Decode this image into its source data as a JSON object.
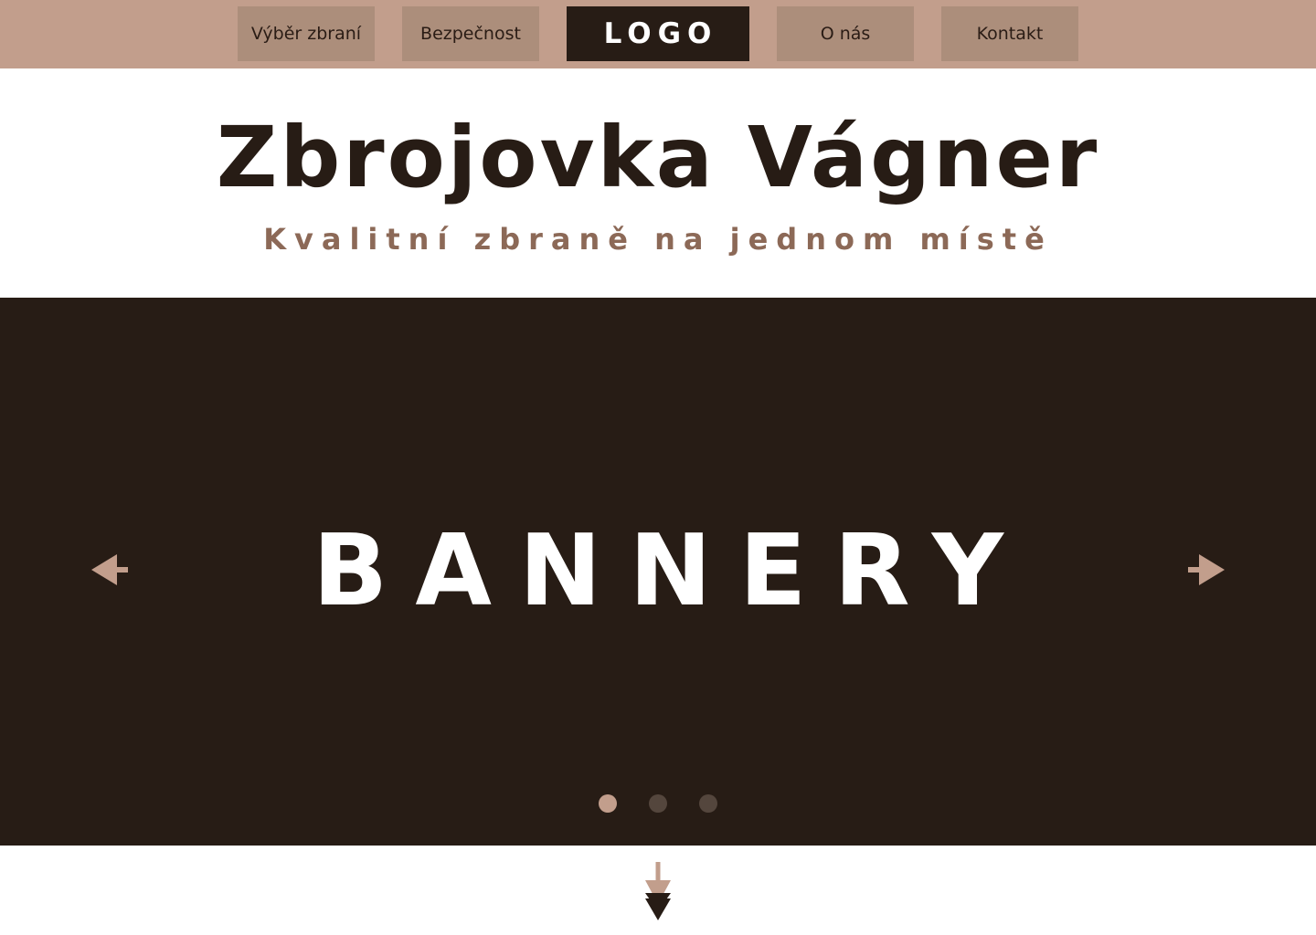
{
  "nav": {
    "left_items": [
      {
        "label": "Výběr zbraní"
      },
      {
        "label": "Bezpečnost"
      }
    ],
    "logo_label": "LOGO",
    "right_items": [
      {
        "label": "O nás"
      },
      {
        "label": "Kontakt"
      }
    ]
  },
  "hero": {
    "title": "Zbrojovka Vágner",
    "subtitle": "Kvalitní zbraně na jednom místě"
  },
  "banner": {
    "text": "BANNERY",
    "slide_count": 3,
    "active_slide": 1
  },
  "icons": {
    "prev": "arrow-left-icon",
    "next": "arrow-right-icon",
    "scroll": "scroll-down-icon"
  },
  "colors": {
    "topbar": "#c29e8c",
    "nav_button": "#ac8e7b",
    "dark": "#271c15",
    "accent": "#8c6957",
    "dot_inactive": "#54463d"
  }
}
